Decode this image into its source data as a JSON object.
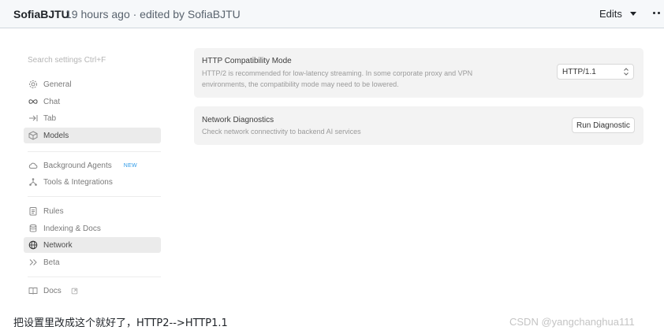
{
  "comment": {
    "author": "SofiaBJTU",
    "meta": "19 hours ago · edited by SofiaBJTU",
    "edits_label": "Edits"
  },
  "settings": {
    "search_placeholder": "Search settings Ctrl+F",
    "nav_groups": [
      [
        {
          "label": "General",
          "icon": "gear-icon"
        },
        {
          "label": "Chat",
          "icon": "infinity-icon"
        },
        {
          "label": "Tab",
          "icon": "tab-arrow-icon"
        },
        {
          "label": "Models",
          "icon": "cube-icon",
          "active": true
        }
      ],
      [
        {
          "label": "Background Agents",
          "icon": "cloud-icon",
          "badge": "NEW"
        },
        {
          "label": "Tools & Integrations",
          "icon": "nodes-icon"
        }
      ],
      [
        {
          "label": "Rules",
          "icon": "clipboard-icon"
        },
        {
          "label": "Indexing & Docs",
          "icon": "database-icon"
        },
        {
          "label": "Network",
          "icon": "globe-icon",
          "active": true
        },
        {
          "label": "Beta",
          "icon": "chevrons-right-icon"
        }
      ],
      [
        {
          "label": "Docs",
          "icon": "book-icon",
          "external_icon": "external-link-icon"
        }
      ]
    ],
    "http_card": {
      "title": "HTTP Compatibility Mode",
      "desc_line1": "HTTP/2 is recommended for low-latency streaming. In some corporate proxy and VPN",
      "desc_line2": "environments, the compatibility mode may need to be lowered.",
      "selected": "HTTP/1.1"
    },
    "diag_card": {
      "title": "Network Diagnostics",
      "desc": "Check network connectivity to backend AI services",
      "button": "Run Diagnostic"
    }
  },
  "caption": "把设置里改成这个就好了，HTTP2-->HTTP1.1",
  "watermark": "CSDN @yangchanghua111"
}
